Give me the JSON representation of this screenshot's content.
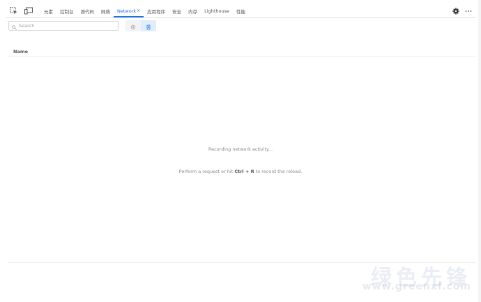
{
  "toolbar": {
    "tabs": [
      {
        "label": "元素"
      },
      {
        "label": "控制台"
      },
      {
        "label": "源代码"
      },
      {
        "label": "网络"
      },
      {
        "label": "Network"
      },
      {
        "label": "应用程序"
      },
      {
        "label": "安全"
      },
      {
        "label": "内存"
      },
      {
        "label": "Lighthouse"
      },
      {
        "label": "性能"
      }
    ],
    "active_tab_close": "×",
    "icons": {
      "inspect": "inspect-element-icon",
      "device": "device-toggle-icon",
      "settings": "gear-icon",
      "more": "more-options-icon"
    },
    "accent_color": "#1a73e8"
  },
  "filter": {
    "search_placeholder": "Search",
    "buttons": [
      {
        "icon": "record-icon"
      },
      {
        "icon": "clear-icon"
      }
    ]
  },
  "table": {
    "columns": [
      {
        "label": "Name"
      }
    ]
  },
  "empty_state": {
    "primary": "Recording network activity...",
    "secondary_before": "Perform a request or hit ",
    "secondary_shortcut": "Ctrl + R",
    "secondary_after": " to record the reload."
  },
  "watermark": {
    "text": "绿色先锋",
    "url": "www.greenxf.com"
  }
}
